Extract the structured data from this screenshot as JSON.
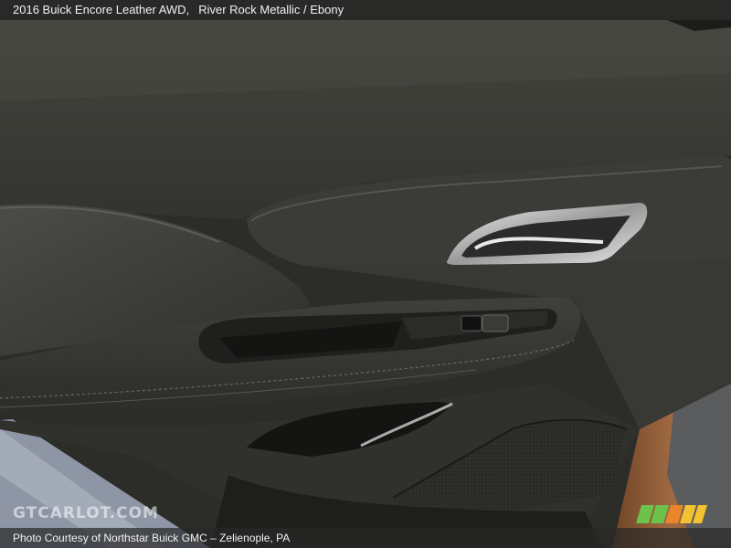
{
  "caption": {
    "vehicle": "2016 Buick Encore Leather AWD,",
    "color": "River Rock Metallic / Ebony"
  },
  "credit": "Photo Courtesy of Northstar Buick GMC – Zelienople, PA",
  "watermark": "GTCARLOT.COM",
  "colors": {
    "door_panel": "#3a3a36",
    "body_paint": "#8a5a35",
    "chrome": "#d8d8d8",
    "ground": "#8e96a6",
    "stripe_green": "#6cc24a",
    "stripe_yellow": "#f2c230",
    "stripe_orange": "#e8862a"
  }
}
